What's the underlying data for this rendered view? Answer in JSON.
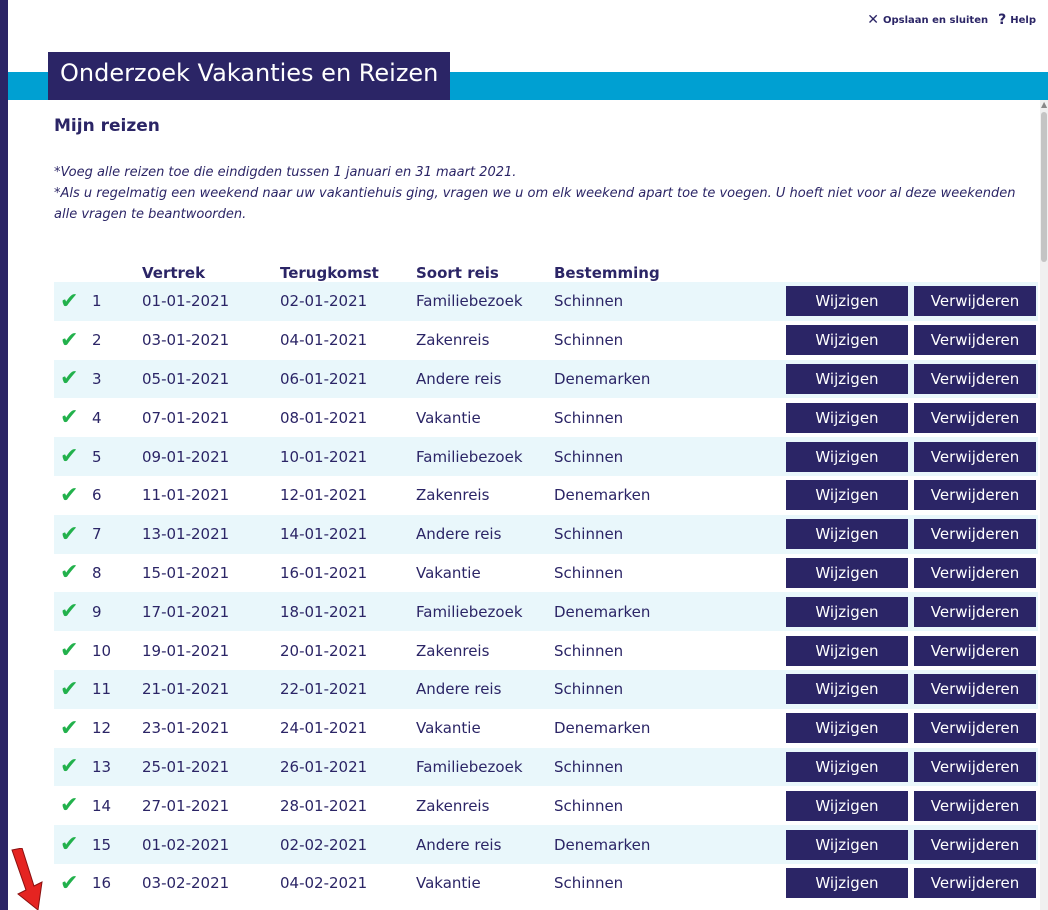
{
  "toolbar": {
    "save_close_icon": "close-icon",
    "save_close_label": "Opslaan en sluiten",
    "help_icon": "question-icon",
    "help_label": "Help"
  },
  "header": {
    "title": "Onderzoek Vakanties en Reizen"
  },
  "page": {
    "section_title": "Mijn reizen",
    "note1": "*Voeg alle reizen toe die eindigden tussen 1 januari en 31 maart 2021.",
    "note2": "*Als u regelmatig een weekend naar uw vakantiehuis ging, vragen we u om elk weekend apart toe te voegen. U hoeft niet voor al deze weekenden alle vragen te beantwoorden."
  },
  "table": {
    "headers": {
      "departure": "Vertrek",
      "return": "Terugkomst",
      "type": "Soort reis",
      "destination": "Bestemming"
    },
    "edit_label": "Wijzigen",
    "delete_label": "Verwijderen",
    "rows": [
      {
        "no": "1",
        "departure": "01-01-2021",
        "return": "02-01-2021",
        "type": "Familiebezoek",
        "destination": "Schinnen"
      },
      {
        "no": "2",
        "departure": "03-01-2021",
        "return": "04-01-2021",
        "type": "Zakenreis",
        "destination": "Schinnen"
      },
      {
        "no": "3",
        "departure": "05-01-2021",
        "return": "06-01-2021",
        "type": "Andere reis",
        "destination": "Denemarken"
      },
      {
        "no": "4",
        "departure": "07-01-2021",
        "return": "08-01-2021",
        "type": "Vakantie",
        "destination": "Schinnen"
      },
      {
        "no": "5",
        "departure": "09-01-2021",
        "return": "10-01-2021",
        "type": "Familiebezoek",
        "destination": "Schinnen"
      },
      {
        "no": "6",
        "departure": "11-01-2021",
        "return": "12-01-2021",
        "type": "Zakenreis",
        "destination": "Denemarken"
      },
      {
        "no": "7",
        "departure": "13-01-2021",
        "return": "14-01-2021",
        "type": "Andere reis",
        "destination": "Schinnen"
      },
      {
        "no": "8",
        "departure": "15-01-2021",
        "return": "16-01-2021",
        "type": "Vakantie",
        "destination": "Schinnen"
      },
      {
        "no": "9",
        "departure": "17-01-2021",
        "return": "18-01-2021",
        "type": "Familiebezoek",
        "destination": "Denemarken"
      },
      {
        "no": "10",
        "departure": "19-01-2021",
        "return": "20-01-2021",
        "type": "Zakenreis",
        "destination": "Schinnen"
      },
      {
        "no": "11",
        "departure": "21-01-2021",
        "return": "22-01-2021",
        "type": "Andere reis",
        "destination": "Schinnen"
      },
      {
        "no": "12",
        "departure": "23-01-2021",
        "return": "24-01-2021",
        "type": "Vakantie",
        "destination": "Denemarken"
      },
      {
        "no": "13",
        "departure": "25-01-2021",
        "return": "26-01-2021",
        "type": "Familiebezoek",
        "destination": "Schinnen"
      },
      {
        "no": "14",
        "departure": "27-01-2021",
        "return": "28-01-2021",
        "type": "Zakenreis",
        "destination": "Schinnen"
      },
      {
        "no": "15",
        "departure": "01-02-2021",
        "return": "02-02-2021",
        "type": "Andere reis",
        "destination": "Denemarken"
      },
      {
        "no": "16",
        "departure": "03-02-2021",
        "return": "04-02-2021",
        "type": "Vakantie",
        "destination": "Schinnen"
      }
    ]
  },
  "colors": {
    "navy": "#2b2566",
    "accent_blue": "#00a0d2",
    "row_stripe": "#e9f7fb",
    "check_green": "#22b14c",
    "arrow_red": "#e52421"
  }
}
